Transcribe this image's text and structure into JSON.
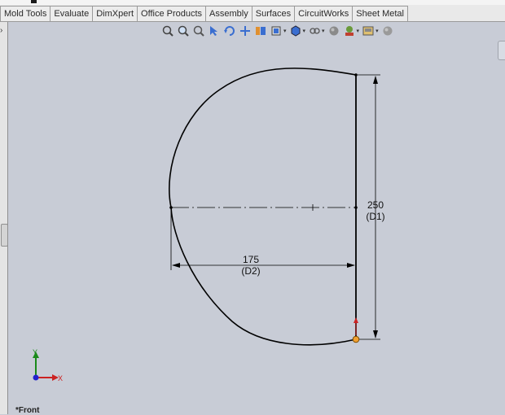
{
  "ribbon_tabs": [
    {
      "id": "mold-tools",
      "label": "Mold Tools"
    },
    {
      "id": "evaluate",
      "label": "Evaluate"
    },
    {
      "id": "dimxpert",
      "label": "DimXpert"
    },
    {
      "id": "office-products",
      "label": "Office Products"
    },
    {
      "id": "assembly",
      "label": "Assembly"
    },
    {
      "id": "surfaces",
      "label": "Surfaces"
    },
    {
      "id": "circuitworks",
      "label": "CircuitWorks"
    },
    {
      "id": "sheet-metal",
      "label": "Sheet Metal"
    }
  ],
  "view_toolbar": [
    {
      "name": "zoom-to-fit-icon",
      "dropdown": false
    },
    {
      "name": "zoom-to-area-icon",
      "dropdown": false
    },
    {
      "name": "zoom-in-out-icon",
      "dropdown": false
    },
    {
      "name": "select-icon",
      "dropdown": false
    },
    {
      "name": "rotate-view-icon",
      "dropdown": false
    },
    {
      "name": "pan-icon",
      "dropdown": false
    },
    {
      "name": "section-view-icon",
      "dropdown": false
    },
    {
      "name": "view-orientation-icon",
      "dropdown": true
    },
    {
      "name": "display-style-icon",
      "dropdown": true
    },
    {
      "name": "hide-show-items-icon",
      "dropdown": true
    },
    {
      "name": "edit-appearance-icon",
      "dropdown": false
    },
    {
      "name": "apply-scene-icon",
      "dropdown": true
    },
    {
      "name": "view-settings-icon",
      "dropdown": true
    },
    {
      "name": "render-tools-icon",
      "dropdown": false
    }
  ],
  "dimensions": {
    "d1": {
      "value": "250",
      "name": "(D1)"
    },
    "d2": {
      "value": "175",
      "name": "(D2)"
    }
  },
  "triad": {
    "y_label": "Y",
    "x_label": "X",
    "y_color": "#1a8a1a",
    "x_color": "#cc2222",
    "z_color": "#2222cc"
  },
  "view_label": "*Front",
  "colors": {
    "canvas": "#c8ccd6",
    "sketch_line": "#000000",
    "origin_point": "#f0a030"
  }
}
